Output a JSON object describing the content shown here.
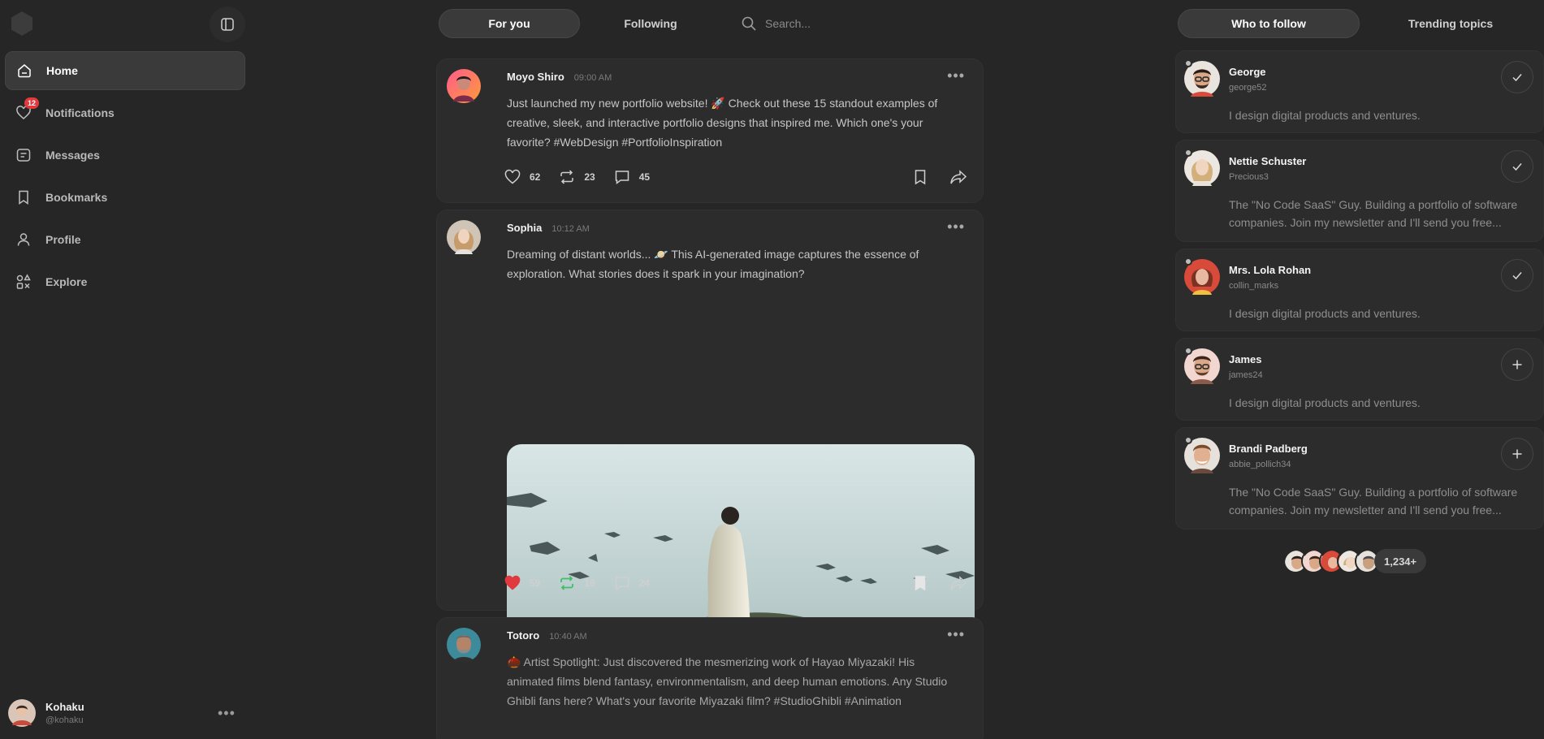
{
  "sidebar": {
    "nav": [
      {
        "label": "Home",
        "icon": "home-icon",
        "active": true
      },
      {
        "label": "Notifications",
        "icon": "heart-icon",
        "badge": "12"
      },
      {
        "label": "Messages",
        "icon": "message-icon"
      },
      {
        "label": "Bookmarks",
        "icon": "bookmark-icon"
      },
      {
        "label": "Profile",
        "icon": "user-icon"
      },
      {
        "label": "Explore",
        "icon": "explore-icon"
      }
    ],
    "user": {
      "name": "Kohaku",
      "handle": "@kohaku"
    }
  },
  "feed_tabs": {
    "for_you": "For you",
    "following": "Following"
  },
  "search": {
    "placeholder": "Search..."
  },
  "posts": [
    {
      "author": "Moyo Shiro",
      "time": "09:00 AM",
      "text": "Just launched my new portfolio website! 🚀 Check out these 15 standout examples of creative, sleek, and interactive portfolio designs that inspired me. Which one's your favorite? #WebDesign #PortfolioInspiration",
      "likes": "62",
      "reposts": "23",
      "comments": "45"
    },
    {
      "author": "Sophia",
      "time": "10:12 AM",
      "text": "Dreaming of distant worlds... 🪐 This AI-generated image captures the essence of exploration. What stories does it spark in your imagination?",
      "likes": "59",
      "reposts": "16",
      "comments": "24",
      "liked": true,
      "reposted": true,
      "bookmarked": true
    },
    {
      "author": "Totoro",
      "time": "10:40 AM",
      "text": "🌰 Artist Spotlight: Just discovered the mesmerizing work of Hayao Miyazaki! His animated films blend fantasy, environmentalism, and deep human emotions. Any Studio Ghibli fans here? What's your favorite Miyazaki film? #StudioGhibli #Animation"
    }
  ],
  "right_tabs": {
    "who_to_follow": "Who to follow",
    "trending": "Trending topics"
  },
  "suggestions": [
    {
      "name": "George",
      "handle": "george52",
      "bio": "I design digital products and ventures.",
      "followed": true
    },
    {
      "name": "Nettie Schuster",
      "handle": "Precious3",
      "bio": "The \"No Code SaaS\" Guy. Building a portfolio of software companies. Join my newsletter and I'll send you free...",
      "followed": true
    },
    {
      "name": "Mrs. Lola Rohan",
      "handle": "collin_marks",
      "bio": "I design digital products and ventures.",
      "followed": true
    },
    {
      "name": "James",
      "handle": "james24",
      "bio": "I design digital products and ventures.",
      "followed": false
    },
    {
      "name": "Brandi Padberg",
      "handle": "abbie_pollich34",
      "bio": "The \"No Code SaaS\" Guy. Building a portfolio of software companies. Join my newsletter and I'll send you free...",
      "followed": false
    }
  ],
  "followers_count": "1,234+",
  "colors": {
    "background": "#262626",
    "card": "#2c2c2c",
    "like_red": "#e0393e",
    "repost_green": "#3fbf6a"
  }
}
